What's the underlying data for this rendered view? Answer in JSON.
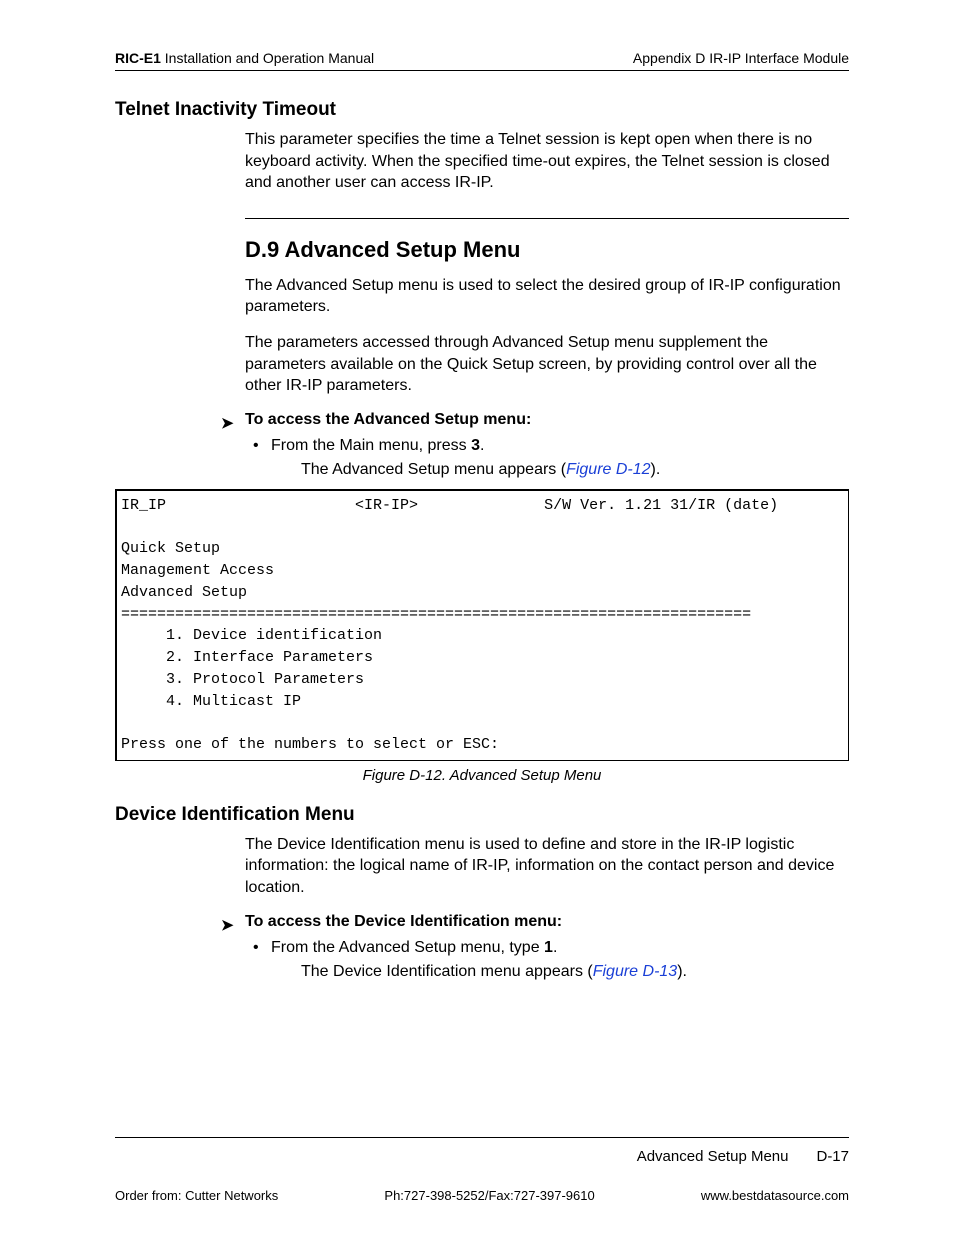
{
  "header": {
    "product": "RIC-E1",
    "manual": " Installation and Operation Manual",
    "appendix": "Appendix D  IR-IP Interface Module"
  },
  "sec_telnet": {
    "title": "Telnet Inactivity Timeout",
    "body": "This parameter specifies the time a Telnet session is kept open when there is no keyboard activity. When the specified time-out expires, the Telnet session is closed and another user can access IR-IP."
  },
  "sec_d9": {
    "title": "D.9 Advanced Setup Menu",
    "p1": "The Advanced Setup menu is used to select the desired group of IR-IP configuration parameters.",
    "p2": "The parameters accessed through Advanced Setup menu supplement the parameters available on the Quick Setup screen, by providing control over all the other IR-IP parameters.",
    "proc_title": "To access the Advanced Setup menu:",
    "bullet_pre": "From the Main menu, press ",
    "bullet_key": "3",
    "bullet_post": ".",
    "result_pre": "The Advanced Setup menu appears (",
    "result_link": "Figure D-12",
    "result_post": ")."
  },
  "terminal": {
    "line1": "IR_IP                     <IR-IP>              S/W Ver. 1.21 31/IR (date)",
    "blank": " ",
    "quick": "Quick Setup",
    "mgmt": "Management Access",
    "adv": "Advanced Setup",
    "rule": "======================================================================",
    "opt1": "     1. Device identification",
    "opt2": "     2. Interface Parameters",
    "opt3": "     3. Protocol Parameters",
    "opt4": "     4. Multicast IP",
    "prompt": "Press one of the numbers to select or ESC:"
  },
  "fig_caption": "Figure D-12.  Advanced Setup Menu",
  "sec_devid": {
    "title": "Device Identification Menu",
    "body": "The Device Identification menu is used to define and store in the IR-IP logistic information: the logical name of IR-IP, information on the contact person and device location.",
    "proc_title": "To access the Device Identification menu:",
    "bullet_pre": "From the Advanced Setup menu, type ",
    "bullet_key": "1",
    "bullet_post": ".",
    "result_pre": "The Device Identification menu appears (",
    "result_link": "Figure D-13",
    "result_post": ")."
  },
  "footer": {
    "sec_label": "Advanced Setup Menu",
    "page": "D-17",
    "order": "Order from: Cutter Networks",
    "phone": "Ph:727-398-5252/Fax:727-397-9610",
    "url": "www.bestdatasource.com"
  }
}
